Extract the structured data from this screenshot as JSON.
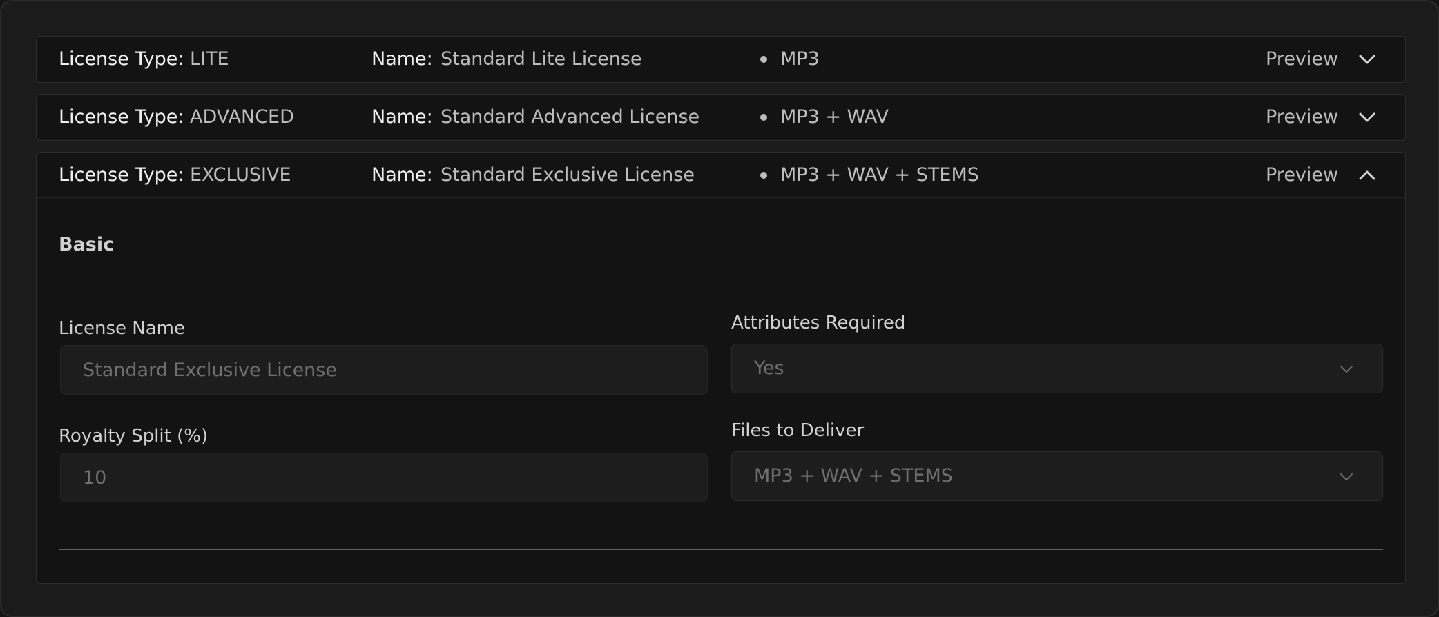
{
  "licenses": [
    {
      "type_label": "License Type:",
      "type_value": "LITE",
      "name_label": "Name:",
      "name_value": "Standard Lite License",
      "files": "MP3",
      "preview_label": "Preview"
    },
    {
      "type_label": "License Type:",
      "type_value": "ADVANCED",
      "name_label": "Name:",
      "name_value": "Standard Advanced License",
      "files": "MP3 + WAV",
      "preview_label": "Preview"
    },
    {
      "type_label": "License Type:",
      "type_value": "EXCLUSIVE",
      "name_label": "Name:",
      "name_value": "Standard Exclusive License",
      "files": "MP3 + WAV + STEMS",
      "preview_label": "Preview"
    }
  ],
  "expanded": {
    "section_title": "Basic",
    "license_name_label": "License Name",
    "license_name_value": "Standard Exclusive License",
    "attributes_label": "Attributes Required",
    "attributes_value": "Yes",
    "royalty_label": "Royalty Split (%)",
    "royalty_value": "10",
    "files_label": "Files to Deliver",
    "files_value": "MP3 + WAV + STEMS"
  },
  "colors": {
    "background": "#1b1b1b",
    "panel": "#131313",
    "input": "#1d1d1d",
    "label": "#f1f1f1",
    "value": "#bdbdbd",
    "muted": "#6f6f6f"
  },
  "icons": {
    "collapsed": "chevron-down-icon",
    "expanded": "chevron-up-icon",
    "select": "chevron-down-icon"
  }
}
